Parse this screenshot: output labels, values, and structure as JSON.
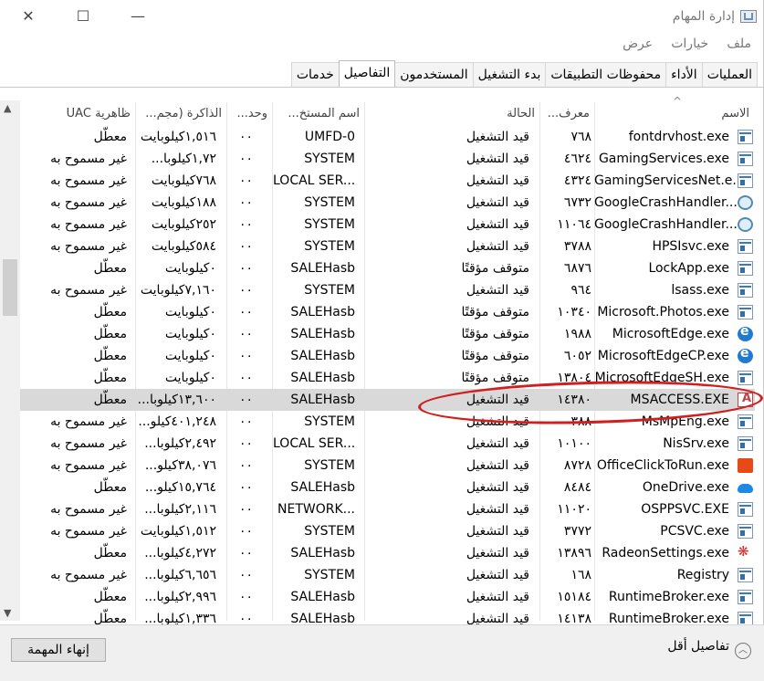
{
  "window": {
    "title": "إدارة المهام",
    "controls": {
      "close": "✕",
      "maximize": "☐",
      "minimize": "—"
    }
  },
  "menu": [
    "ملف",
    "خيارات",
    "عرض"
  ],
  "tabs": [
    {
      "label": "العمليات",
      "active": false
    },
    {
      "label": "الأداء",
      "active": false
    },
    {
      "label": "محفوظات التطبيقات",
      "active": false
    },
    {
      "label": "بدء التشغيل",
      "active": false
    },
    {
      "label": "المستخدمون",
      "active": false
    },
    {
      "label": "التفاصيل",
      "active": true
    },
    {
      "label": "خدمات",
      "active": false
    }
  ],
  "columns": {
    "name": "الاسم",
    "pid": "معرف...",
    "status": "الحالة",
    "user": "اسم المستخ...",
    "cpu": "وحد...",
    "memory": "الذاكرة (مجم...",
    "uac": "ظاهرية UAC"
  },
  "rows": [
    {
      "icon": "windows-exe",
      "name": "fontdrvhost.exe",
      "pid": "٧٦٨",
      "status": "قيد التشغيل",
      "user": "UMFD-0",
      "cpu": "٠٠",
      "memory": "١,٥١٦كيلوبايت",
      "uac": "معطّل",
      "selected": false
    },
    {
      "icon": "windows-exe",
      "name": "GamingServices.exe",
      "pid": "٤٦٢٤",
      "status": "قيد التشغيل",
      "user": "SYSTEM",
      "cpu": "٠٠",
      "memory": "١,٧٢كيلوبا...",
      "uac": "غير مسموح به",
      "selected": false
    },
    {
      "icon": "windows-exe",
      "name": "GamingServicesNet.e...",
      "pid": "٤٣٢٤",
      "status": "قيد التشغيل",
      "user": "LOCAL SER...",
      "cpu": "٠٠",
      "memory": "٧٦٨كيلوبايت",
      "uac": "غير مسموح به",
      "selected": false
    },
    {
      "icon": "crash-handler",
      "name": "GoogleCrashHandler...",
      "pid": "٦٧٣٢",
      "status": "قيد التشغيل",
      "user": "SYSTEM",
      "cpu": "٠٠",
      "memory": "١٨٨كيلوبايت",
      "uac": "غير مسموح به",
      "selected": false
    },
    {
      "icon": "crash-handler",
      "name": "GoogleCrashHandler...",
      "pid": "١١٠٦٤",
      "status": "قيد التشغيل",
      "user": "SYSTEM",
      "cpu": "٠٠",
      "memory": "٢٥٢كيلوبايت",
      "uac": "غير مسموح به",
      "selected": false
    },
    {
      "icon": "windows-exe",
      "name": "HPSIsvc.exe",
      "pid": "٣٧٨٨",
      "status": "قيد التشغيل",
      "user": "SYSTEM",
      "cpu": "٠٠",
      "memory": "٥٨٤كيلوبايت",
      "uac": "غير مسموح به",
      "selected": false
    },
    {
      "icon": "windows-exe",
      "name": "LockApp.exe",
      "pid": "٦٨٧٦",
      "status": "متوقف مؤقتًا",
      "user": "SALEHasb",
      "cpu": "٠٠",
      "memory": "٠كيلوبايت",
      "uac": "معطّل",
      "selected": false
    },
    {
      "icon": "windows-exe",
      "name": "lsass.exe",
      "pid": "٩٦٤",
      "status": "قيد التشغيل",
      "user": "SYSTEM",
      "cpu": "٠٠",
      "memory": "٧,١٦٠كيلوبايت",
      "uac": "غير مسموح به",
      "selected": false
    },
    {
      "icon": "windows-exe",
      "name": "Microsoft.Photos.exe",
      "pid": "١٠٣٤٠",
      "status": "متوقف مؤقتًا",
      "user": "SALEHasb",
      "cpu": "٠٠",
      "memory": "٠كيلوبايت",
      "uac": "معطّل",
      "selected": false
    },
    {
      "icon": "edge",
      "name": "MicrosoftEdge.exe",
      "pid": "١٩٨٨",
      "status": "متوقف مؤقتًا",
      "user": "SALEHasb",
      "cpu": "٠٠",
      "memory": "٠كيلوبايت",
      "uac": "معطّل",
      "selected": false
    },
    {
      "icon": "edge",
      "name": "MicrosoftEdgeCP.exe",
      "pid": "٦٠٥٢",
      "status": "متوقف مؤقتًا",
      "user": "SALEHasb",
      "cpu": "٠٠",
      "memory": "٠كيلوبايت",
      "uac": "معطّل",
      "selected": false
    },
    {
      "icon": "windows-exe",
      "name": "MicrosoftEdgeSH.exe",
      "pid": "١٣٨٠٤",
      "status": "متوقف مؤقتًا",
      "user": "SALEHasb",
      "cpu": "٠٠",
      "memory": "٠كيلوبايت",
      "uac": "معطّل",
      "selected": false
    },
    {
      "icon": "access",
      "name": "MSACCESS.EXE",
      "pid": "١٤٣٨٠",
      "status": "قيد التشغيل",
      "user": "SALEHasb",
      "cpu": "٠٠",
      "memory": "١٣,٦٠٠كيلوبا...",
      "uac": "معطّل",
      "selected": true
    },
    {
      "icon": "windows-exe",
      "name": "MsMpEng.exe",
      "pid": "٣٨٨",
      "status": "قيد التشغيل",
      "user": "SYSTEM",
      "cpu": "٠٠",
      "memory": "٤٠١,٢٤٨كيلو...",
      "uac": "غير مسموح به",
      "selected": false
    },
    {
      "icon": "windows-exe",
      "name": "NisSrv.exe",
      "pid": "١٠١٠٠",
      "status": "قيد التشغيل",
      "user": "LOCAL SER...",
      "cpu": "٠٠",
      "memory": "٢,٤٩٢كيلوبا...",
      "uac": "غير مسموح به",
      "selected": false
    },
    {
      "icon": "office",
      "name": "OfficeClickToRun.exe",
      "pid": "٨٧٢٨",
      "status": "قيد التشغيل",
      "user": "SYSTEM",
      "cpu": "٠٠",
      "memory": "٣٨,٠٧٦كيلو...",
      "uac": "غير مسموح به",
      "selected": false
    },
    {
      "icon": "onedrive",
      "name": "OneDrive.exe",
      "pid": "٨٤٨٤",
      "status": "قيد التشغيل",
      "user": "SALEHasb",
      "cpu": "٠٠",
      "memory": "١٥,٧٦٤كيلو...",
      "uac": "معطّل",
      "selected": false
    },
    {
      "icon": "windows-exe",
      "name": "OSPPSVC.EXE",
      "pid": "١١٠٢٠",
      "status": "قيد التشغيل",
      "user": "NETWORK...",
      "cpu": "٠٠",
      "memory": "٢,١١٦كيلوبا...",
      "uac": "غير مسموح به",
      "selected": false
    },
    {
      "icon": "windows-exe",
      "name": "PCSVC.exe",
      "pid": "٣٧٧٢",
      "status": "قيد التشغيل",
      "user": "SYSTEM",
      "cpu": "٠٠",
      "memory": "١,٥١٢كيلوبايت",
      "uac": "غير مسموح به",
      "selected": false
    },
    {
      "icon": "radeon",
      "name": "RadeonSettings.exe",
      "pid": "١٣٨٩٦",
      "status": "قيد التشغيل",
      "user": "SALEHasb",
      "cpu": "٠٠",
      "memory": "٤,٢٧٢كيلوبا...",
      "uac": "معطّل",
      "selected": false
    },
    {
      "icon": "windows-exe",
      "name": "Registry",
      "pid": "١٦٨",
      "status": "قيد التشغيل",
      "user": "SYSTEM",
      "cpu": "٠٠",
      "memory": "٦,٦٥٦كيلوبا...",
      "uac": "غير مسموح به",
      "selected": false
    },
    {
      "icon": "windows-exe",
      "name": "RuntimeBroker.exe",
      "pid": "١٥١٨٤",
      "status": "قيد التشغيل",
      "user": "SALEHasb",
      "cpu": "٠٠",
      "memory": "٢,٩٩٦كيلوبا...",
      "uac": "معطّل",
      "selected": false
    },
    {
      "icon": "windows-exe",
      "name": "RuntimeBroker.exe",
      "pid": "١٤١٣٨",
      "status": "قيد التشغيل",
      "user": "SALEHasb",
      "cpu": "٠٠",
      "memory": "١,٣٣٦كيلوبا...",
      "uac": "معطّل",
      "selected": false
    }
  ],
  "footer": {
    "end_task": "إنهاء المهمة",
    "fewer_details": "تفاصيل أقل"
  },
  "annotation_color": "#d11f1f"
}
